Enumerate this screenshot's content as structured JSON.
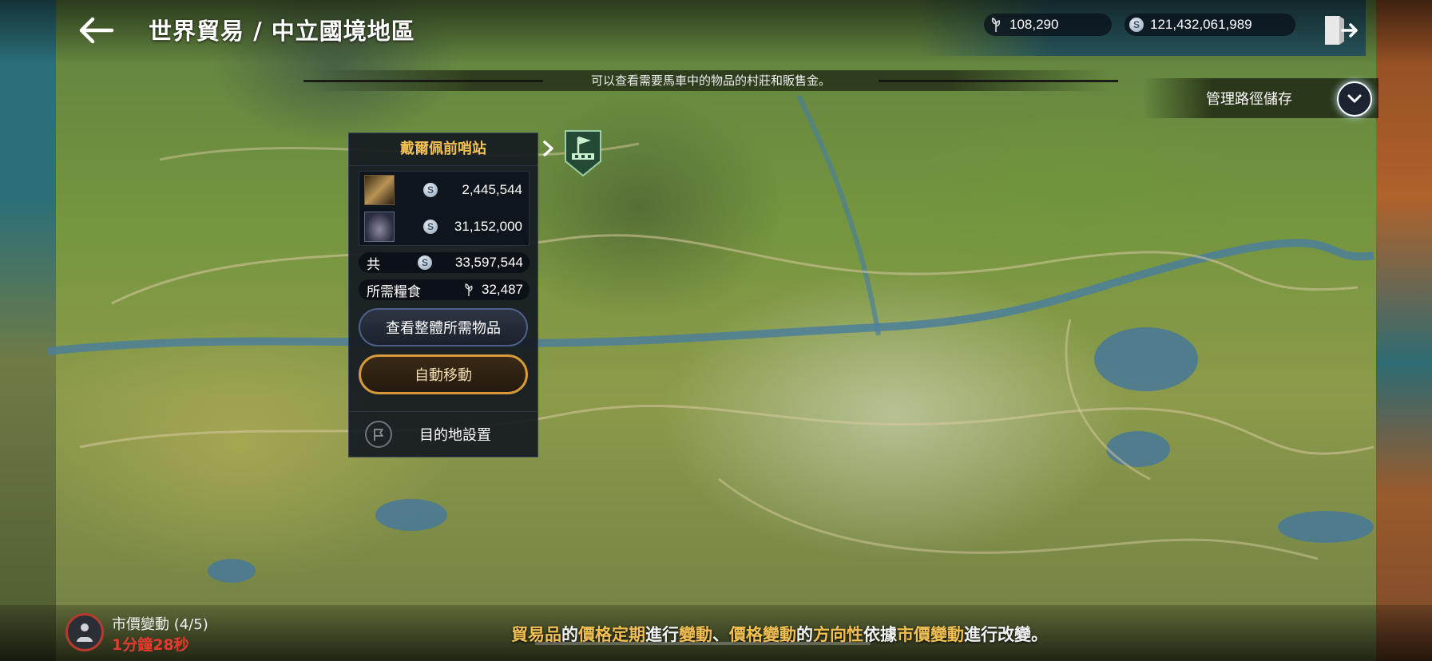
{
  "header": {
    "title": "世界貿易 / 中立國境地區",
    "food_amount": "108,290",
    "silver_amount": "121,432,061,989",
    "back_icon": "arrow-left-icon",
    "exit_icon": "exit-door-icon"
  },
  "notice": "可以查看需要馬車中的物品的村莊和販售金。",
  "route_save": {
    "label": "管理路徑儲存",
    "icon": "chevron-down-icon"
  },
  "panel": {
    "title": "戴爾佩前哨站",
    "items": [
      {
        "value": "2,445,544"
      },
      {
        "value": "31,152,000"
      }
    ],
    "total_label": "共",
    "total_value": "33,597,544",
    "food_label": "所需糧食",
    "food_value": "32,487",
    "view_button": "查看整體所需物品",
    "auto_button": "自動移動",
    "dest_label": "目的地設置"
  },
  "market": {
    "label": "市價變動 (4/5)",
    "timer": "1分鐘28秒"
  },
  "tip": {
    "p1": "貿易品",
    "p2": "的",
    "p3": "價格定期",
    "p4": "進行",
    "p5": "變動",
    "p6": "、",
    "p7": "價格變動",
    "p8": "的",
    "p9": "方向性",
    "p10": "依據",
    "p11": "市價變動",
    "p12": "進行改變。"
  },
  "colors": {
    "accent_gold": "#f2c052",
    "timer_red": "#e63a2e",
    "auto_border": "#d59a3a"
  }
}
